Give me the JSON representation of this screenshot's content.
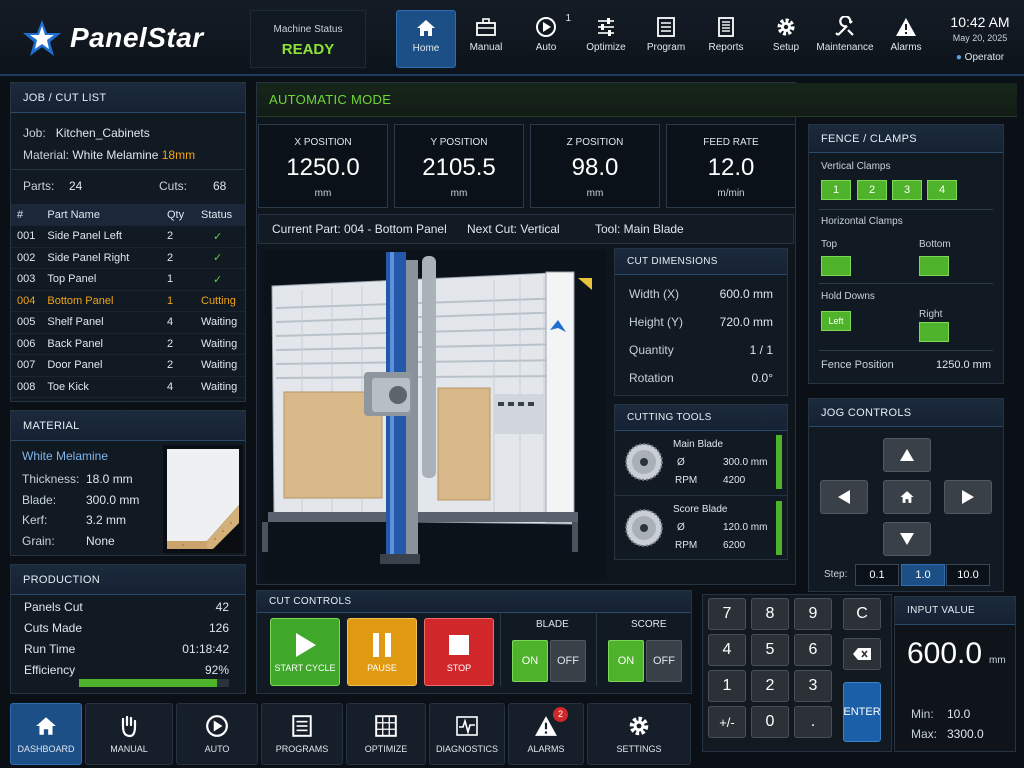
{
  "header": {
    "brand": "PanelStar",
    "machine_status_label": "Machine Status",
    "machine_status_value": "READY",
    "nav": [
      {
        "label": "Home",
        "icon": "home-icon"
      },
      {
        "label": "Manual",
        "icon": "toolbox-icon"
      },
      {
        "label": "Auto",
        "icon": "auto-cycle-icon",
        "badge": "1"
      },
      {
        "label": "Optimize",
        "icon": "sliders-icon"
      },
      {
        "label": "Program",
        "icon": "program-list-icon"
      },
      {
        "label": "Reports",
        "icon": "report-icon"
      },
      {
        "label": "Setup",
        "icon": "gear-icon"
      },
      {
        "label": "Maintenance",
        "icon": "wrench-icon"
      },
      {
        "label": "Alarms",
        "icon": "warning-icon"
      }
    ],
    "time": "10:42 AM",
    "date": "May 20, 2025",
    "user": "Operator"
  },
  "job": {
    "title": "JOB / CUT LIST",
    "job_label": "Job:",
    "job_value": "Kitchen_Cabinets",
    "material_label": "Material:",
    "material_value": "White Melamine",
    "material_thickness": "18mm",
    "parts_label": "Parts:",
    "parts_value": "24",
    "cuts_label": "Cuts:",
    "cuts_value": "68",
    "columns": [
      "#",
      "Part Name",
      "Qty",
      "Status"
    ],
    "rows": [
      {
        "num": "001",
        "name": "Side Panel Left",
        "qty": "2",
        "status": "✓",
        "state": "done"
      },
      {
        "num": "002",
        "name": "Side Panel Right",
        "qty": "2",
        "status": "✓",
        "state": "done"
      },
      {
        "num": "003",
        "name": "Top Panel",
        "qty": "1",
        "status": "✓",
        "state": "done"
      },
      {
        "num": "004",
        "name": "Bottom Panel",
        "qty": "1",
        "status": "Cutting",
        "state": "current"
      },
      {
        "num": "005",
        "name": "Shelf Panel",
        "qty": "4",
        "status": "Waiting",
        "state": "waiting"
      },
      {
        "num": "006",
        "name": "Back Panel",
        "qty": "2",
        "status": "Waiting",
        "state": "waiting"
      },
      {
        "num": "007",
        "name": "Door Panel",
        "qty": "2",
        "status": "Waiting",
        "state": "waiting"
      },
      {
        "num": "008",
        "name": "Toe Kick",
        "qty": "4",
        "status": "Waiting",
        "state": "waiting"
      }
    ]
  },
  "material": {
    "title": "MATERIAL",
    "name": "White Melamine",
    "thickness_label": "Thickness:",
    "thickness_value": "18.0 mm",
    "blade_label": "Blade:",
    "blade_value": "300.0 mm",
    "kerf_label": "Kerf:",
    "kerf_value": "3.2 mm",
    "grain_label": "Grain:",
    "grain_value": "None"
  },
  "production": {
    "title": "PRODUCTION",
    "panels_label": "Panels Cut",
    "panels_value": "42",
    "cuts_label": "Cuts Made",
    "cuts_value": "126",
    "runtime_label": "Run Time",
    "runtime_value": "01:18:42",
    "efficiency_label": "Efficiency",
    "efficiency_value": "92%",
    "efficiency_fraction": 0.92
  },
  "auto": {
    "title": "AUTOMATIC MODE",
    "positions": [
      {
        "label": "X POSITION",
        "value": "1250.0",
        "unit": "mm"
      },
      {
        "label": "Y POSITION",
        "value": "2105.5",
        "unit": "mm"
      },
      {
        "label": "Z POSITION",
        "value": "98.0",
        "unit": "mm"
      },
      {
        "label": "FEED RATE",
        "value": "12.0",
        "unit": "m/min"
      }
    ],
    "current_part": "Current Part: 004 - Bottom Panel",
    "next_cut": "Next Cut: Vertical",
    "tool": "Tool: Main Blade"
  },
  "cut_dimensions": {
    "title": "CUT DIMENSIONS",
    "rows": [
      {
        "label": "Width (X)",
        "value": "600.0 mm"
      },
      {
        "label": "Height (Y)",
        "value": "720.0 mm"
      },
      {
        "label": "Quantity",
        "value": "1 / 1"
      },
      {
        "label": "Rotation",
        "value": "0.0°"
      }
    ]
  },
  "tools": {
    "title": "CUTTING TOOLS",
    "items": [
      {
        "name": "Main Blade",
        "dia_label": "Ø",
        "dia": "300.0 mm",
        "rpm_label": "RPM",
        "rpm": "4200"
      },
      {
        "name": "Score Blade",
        "dia_label": "Ø",
        "dia": "120.0 mm",
        "rpm_label": "RPM",
        "rpm": "6200"
      }
    ]
  },
  "fence": {
    "title": "FENCE / CLAMPS",
    "vertical_label": "Vertical Clamps",
    "vertical": [
      "1",
      "2",
      "3",
      "4"
    ],
    "horizontal_label": "Horizontal Clamps",
    "top_label": "Top",
    "bottom_label": "Bottom",
    "holddowns_label": "Hold Downs",
    "left_label": "Left",
    "right_label": "Right",
    "fence_label": "Fence Position",
    "fence_value": "1250.0 mm"
  },
  "jog": {
    "title": "JOG CONTROLS",
    "step_label": "Step:",
    "steps": [
      "0.1",
      "1.0",
      "10.0"
    ],
    "selected_step": "1.0"
  },
  "cut_controls": {
    "title": "CUT CONTROLS",
    "start": "START CYCLE",
    "pause": "PAUSE",
    "stop": "STOP",
    "blade_label": "BLADE",
    "score_label": "SCORE",
    "on": "ON",
    "off": "OFF"
  },
  "keypad": {
    "keys": [
      "7",
      "8",
      "9",
      "4",
      "5",
      "6",
      "1",
      "2",
      "3",
      "+/-",
      "0",
      "."
    ],
    "clear": "C",
    "enter": "ENTER"
  },
  "input": {
    "title": "INPUT VALUE",
    "value": "600.0",
    "unit": "mm",
    "min_label": "Min:",
    "min": "10.0",
    "max_label": "Max:",
    "max": "3300.0"
  },
  "bottom_nav": [
    {
      "label": "DASHBOARD",
      "icon": "home-icon"
    },
    {
      "label": "MANUAL",
      "icon": "hand-icon"
    },
    {
      "label": "AUTO",
      "icon": "auto-cycle-icon"
    },
    {
      "label": "PROGRAMS",
      "icon": "program-list-icon"
    },
    {
      "label": "OPTIMIZE",
      "icon": "grid-icon"
    },
    {
      "label": "DIAGNOSTICS",
      "icon": "pulse-icon"
    },
    {
      "label": "ALARMS",
      "icon": "warning-icon",
      "badge": "2"
    },
    {
      "label": "SETTINGS",
      "icon": "gear-icon"
    }
  ],
  "colors": {
    "accent": "#1b4f86",
    "ok": "#5fd23a",
    "current": "#f0a318",
    "start": "#3fa82a",
    "pause": "#e09a12",
    "stop": "#d0282a"
  }
}
